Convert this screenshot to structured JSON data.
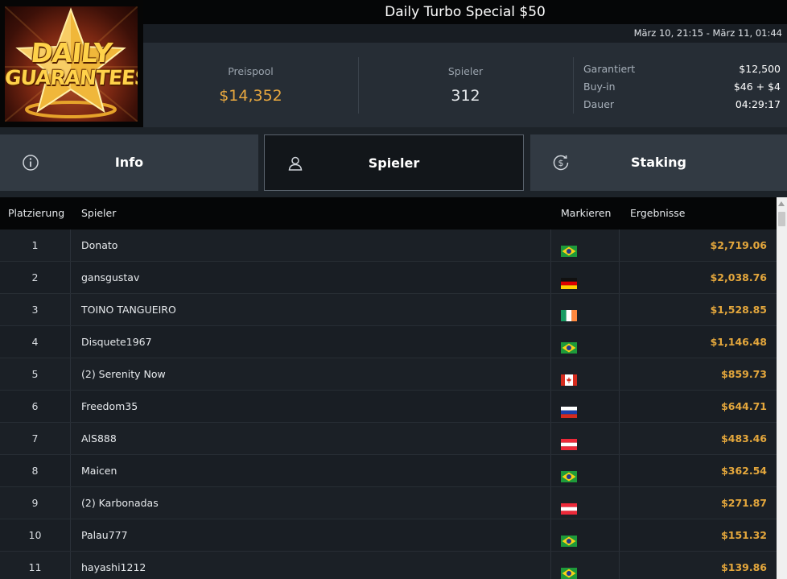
{
  "logo": {
    "line1": "DAILY",
    "line2": "GUARANTEES",
    "icon": "star-logo-icon"
  },
  "header": {
    "title": "Daily Turbo Special $50",
    "date_range": "März 10, 21:15 - März 11, 01:44"
  },
  "stats": {
    "prize_pool": {
      "label": "Preispool",
      "value": "$14,352"
    },
    "players": {
      "label": "Spieler",
      "value": "312"
    },
    "details": [
      {
        "label": "Garantiert",
        "value": "$12,500"
      },
      {
        "label": "Buy-in",
        "value": "$46 + $4"
      },
      {
        "label": "Dauer",
        "value": "04:29:17"
      }
    ]
  },
  "tabs": [
    {
      "label": "Info",
      "icon": "info-icon",
      "active": false
    },
    {
      "label": "Spieler",
      "icon": "user-icon",
      "active": true
    },
    {
      "label": "Staking",
      "icon": "dollar-coin-icon",
      "active": false
    }
  ],
  "table": {
    "columns": {
      "rank": "Platzierung",
      "player": "Spieler",
      "flag": "Markieren",
      "result": "Ergebnisse"
    },
    "rows": [
      {
        "rank": "1",
        "name": "Donato",
        "flag": "brazil",
        "result": "$2,719.06"
      },
      {
        "rank": "2",
        "name": "gansgustav",
        "flag": "germany",
        "result": "$2,038.76"
      },
      {
        "rank": "3",
        "name": "TOINO TANGUEIRO",
        "flag": "ireland",
        "result": "$1,528.85"
      },
      {
        "rank": "4",
        "name": "Disquete1967",
        "flag": "brazil",
        "result": "$1,146.48"
      },
      {
        "rank": "5",
        "name": "(2) Serenity Now",
        "flag": "canada",
        "result": "$859.73"
      },
      {
        "rank": "6",
        "name": "Freedom35",
        "flag": "russia",
        "result": "$644.71"
      },
      {
        "rank": "7",
        "name": "AlS888",
        "flag": "austria",
        "result": "$483.46"
      },
      {
        "rank": "8",
        "name": "Maicen",
        "flag": "brazil",
        "result": "$362.54"
      },
      {
        "rank": "9",
        "name": "(2) Karbonadas",
        "flag": "austria",
        "result": "$271.87"
      },
      {
        "rank": "10",
        "name": "Palau777",
        "flag": "brazil",
        "result": "$151.32"
      },
      {
        "rank": "11",
        "name": "hayashi1212",
        "flag": "brazil",
        "result": "$139.86"
      }
    ]
  },
  "colors": {
    "accent_gold": "#e8a83f",
    "background": "#14181d",
    "panel": "#262d35"
  }
}
